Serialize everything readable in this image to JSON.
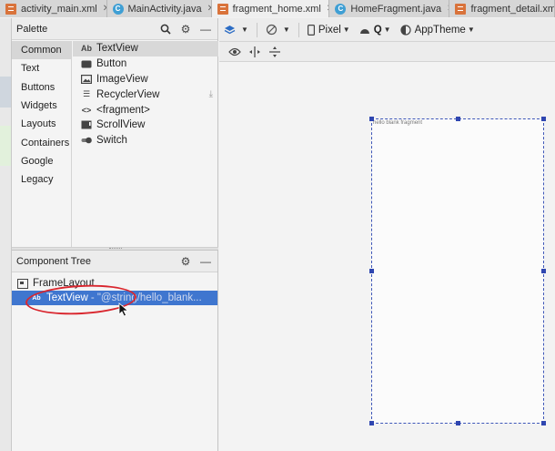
{
  "tabs": [
    {
      "label": "activity_main.xml",
      "type": "xml",
      "active": false
    },
    {
      "label": "MainActivity.java",
      "type": "java",
      "active": false
    },
    {
      "label": "fragment_home.xml",
      "type": "xml",
      "active": true
    },
    {
      "label": "HomeFragment.java",
      "type": "java",
      "active": false
    },
    {
      "label": "fragment_detail.xml",
      "type": "xml",
      "active": false
    }
  ],
  "palette": {
    "title": "Palette",
    "categories": [
      "Common",
      "Text",
      "Buttons",
      "Widgets",
      "Layouts",
      "Containers",
      "Google",
      "Legacy"
    ],
    "selected_category": "Common",
    "items": [
      {
        "label": "TextView",
        "icon": "text-ab-icon"
      },
      {
        "label": "Button",
        "icon": "button-icon"
      },
      {
        "label": "ImageView",
        "icon": "image-icon"
      },
      {
        "label": "RecyclerView",
        "icon": "list-icon",
        "download": true
      },
      {
        "label": "<fragment>",
        "icon": "code-brackets-icon"
      },
      {
        "label": "ScrollView",
        "icon": "scroll-icon"
      },
      {
        "label": "Switch",
        "icon": "toggle-icon"
      }
    ]
  },
  "component_tree": {
    "title": "Component Tree",
    "root": "FrameLayout",
    "child": {
      "label": "TextView",
      "meta": "- \"@string/hello_blank..."
    }
  },
  "toolbar": {
    "device": "Pixel",
    "api": "Q",
    "theme": "AppTheme"
  },
  "canvas": {
    "text": "hello blank fragment"
  },
  "colors": {
    "selection": "#3f76cf",
    "annotation": "#d9262e",
    "blueprint": "#2f46b0"
  }
}
